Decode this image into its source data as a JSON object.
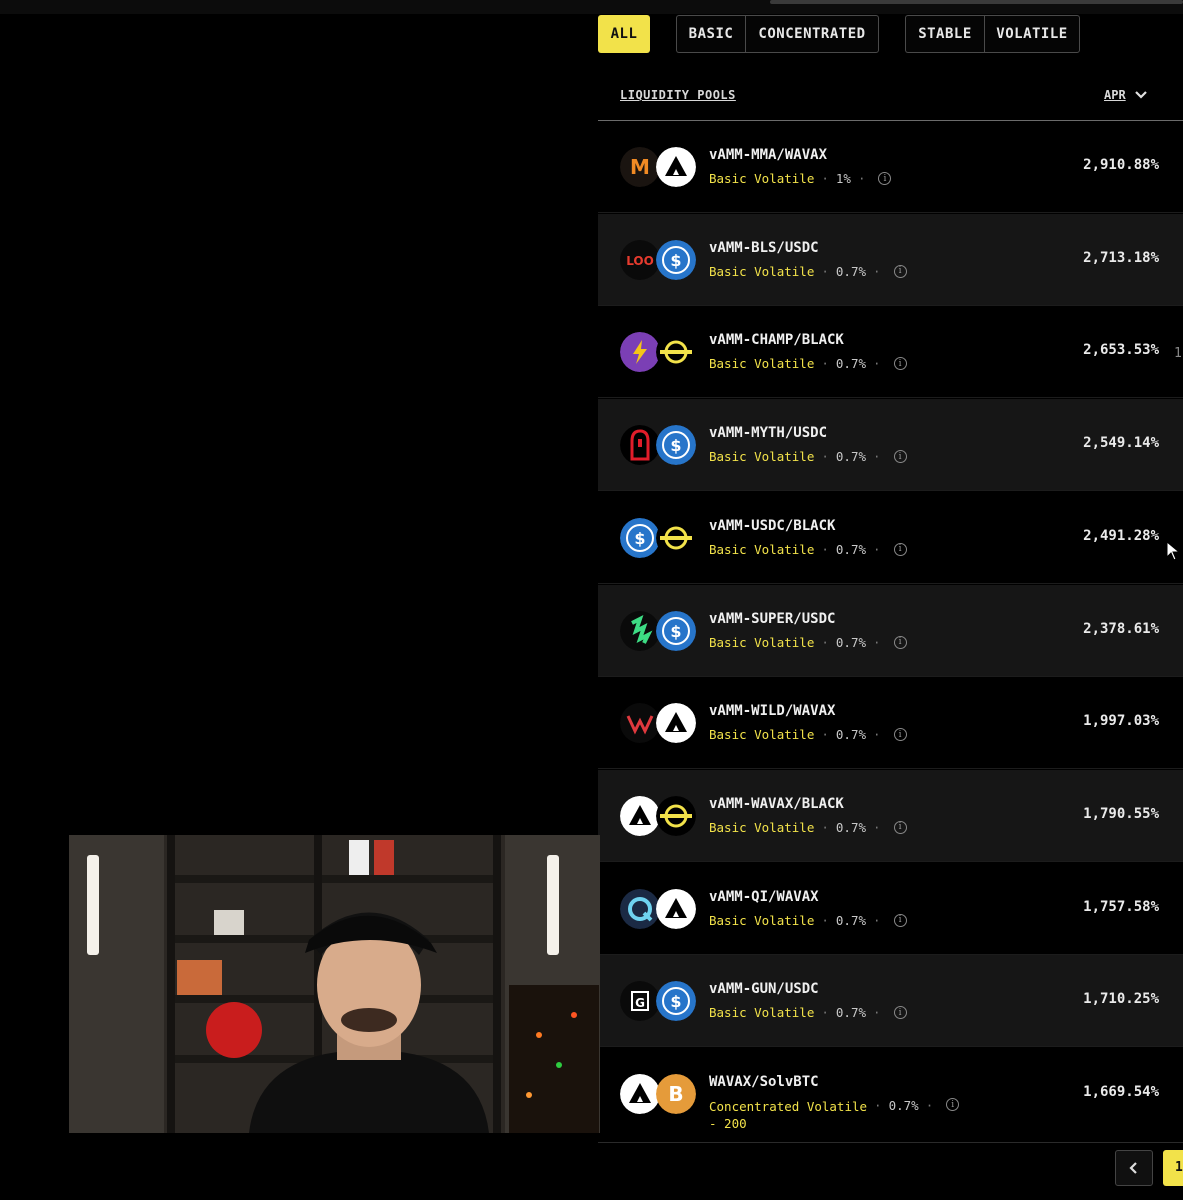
{
  "filters": {
    "all": "ALL",
    "basic": "BASIC",
    "concentrated": "CONCENTRATED",
    "stable": "STABLE",
    "volatile": "VOLATILE"
  },
  "table": {
    "header_pools": "LIQUIDITY POOLS",
    "header_apr": "APR",
    "rows": [
      {
        "pair": "vAMM-MMA/WAVAX",
        "type": "Basic Volatile",
        "fee": "1%",
        "apr": "2,910.88%",
        "icons": [
          "mma-token-icon",
          "avax-token-icon"
        ]
      },
      {
        "pair": "vAMM-BLS/USDC",
        "type": "Basic Volatile",
        "fee": "0.7%",
        "apr": "2,713.18%",
        "icons": [
          "bls-token-icon",
          "usdc-token-icon"
        ]
      },
      {
        "pair": "vAMM-CHAMP/BLACK",
        "type": "Basic Volatile",
        "fee": "0.7%",
        "apr": "2,653.53%",
        "icons": [
          "champ-token-icon",
          "black-token-icon"
        ]
      },
      {
        "pair": "vAMM-MYTH/USDC",
        "type": "Basic Volatile",
        "fee": "0.7%",
        "apr": "2,549.14%",
        "icons": [
          "myth-token-icon",
          "usdc-token-icon"
        ]
      },
      {
        "pair": "vAMM-USDC/BLACK",
        "type": "Basic Volatile",
        "fee": "0.7%",
        "apr": "2,491.28%",
        "icons": [
          "usdc-token-icon",
          "black-token-icon"
        ]
      },
      {
        "pair": "vAMM-SUPER/USDC",
        "type": "Basic Volatile",
        "fee": "0.7%",
        "apr": "2,378.61%",
        "icons": [
          "super-token-icon",
          "usdc-token-icon"
        ]
      },
      {
        "pair": "vAMM-WILD/WAVAX",
        "type": "Basic Volatile",
        "fee": "0.7%",
        "apr": "1,997.03%",
        "icons": [
          "wild-token-icon",
          "avax-token-icon"
        ]
      },
      {
        "pair": "vAMM-WAVAX/BLACK",
        "type": "Basic Volatile",
        "fee": "0.7%",
        "apr": "1,790.55%",
        "icons": [
          "avax-token-icon",
          "black-token-icon"
        ]
      },
      {
        "pair": "vAMM-QI/WAVAX",
        "type": "Basic Volatile",
        "fee": "0.7%",
        "apr": "1,757.58%",
        "icons": [
          "qi-token-icon",
          "avax-token-icon"
        ]
      },
      {
        "pair": "vAMM-GUN/USDC",
        "type": "Basic Volatile",
        "fee": "0.7%",
        "apr": "1,710.25%",
        "icons": [
          "gun-token-icon",
          "usdc-token-icon"
        ]
      }
    ],
    "last_row": {
      "pair": "WAVAX/SolvBTC",
      "type_line1": "Concentrated Volatile",
      "type_line2": "- 200",
      "fee": "0.7%",
      "apr": "1,669.54%",
      "icons": [
        "avax-token-icon",
        "solvbtc-token-icon"
      ]
    }
  },
  "pagination": {
    "current_page": "1"
  },
  "edge_text": "1",
  "colors": {
    "accent": "#f2e24a",
    "background": "#000000",
    "row_alt": "#161616",
    "usdc": "#2775ca"
  }
}
